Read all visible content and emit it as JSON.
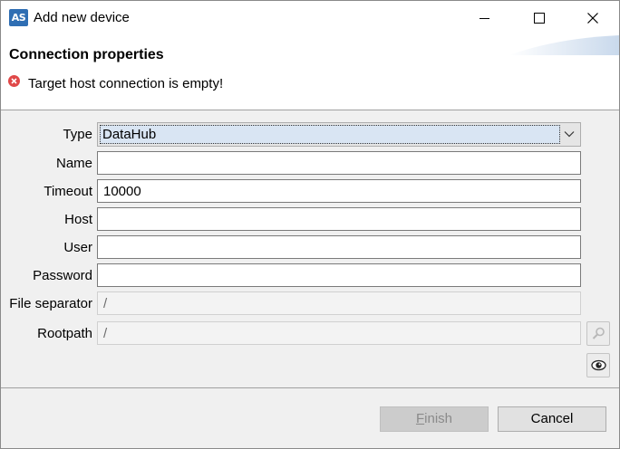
{
  "window": {
    "app_icon_text": "AS",
    "title": "Add new device"
  },
  "header": {
    "title": "Connection properties",
    "error_message": "Target host connection is empty!"
  },
  "form": {
    "type_label": "Type",
    "type_value": "DataHub",
    "name_label": "Name",
    "name_value": "",
    "timeout_label": "Timeout",
    "timeout_value": "10000",
    "host_label": "Host",
    "host_value": "",
    "user_label": "User",
    "user_value": "",
    "password_label": "Password",
    "password_value": "",
    "file_separator_label": "File separator",
    "file_separator_value": "/",
    "rootpath_label": "Rootpath",
    "rootpath_value": "/"
  },
  "icons": {
    "app": "automation-studio-icon",
    "error": "error-icon",
    "browse": "search-icon",
    "show": "eye-icon"
  },
  "footer": {
    "finish_mnemonic": "F",
    "finish_rest": "inish",
    "cancel_label": "Cancel"
  },
  "colors": {
    "error_red": "#e04848",
    "select_highlight": "#d9e5f3",
    "dialog_bg": "#f0f0f0"
  }
}
